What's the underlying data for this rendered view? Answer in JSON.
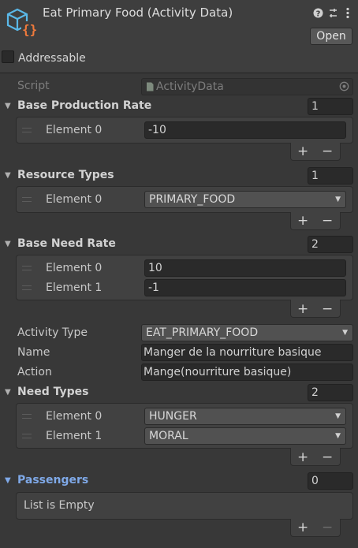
{
  "header": {
    "title": "Eat Primary Food (Activity Data)",
    "open_label": "Open",
    "icons": {
      "component": "cube-script-icon",
      "help": "question-icon",
      "presets": "sliders-icon",
      "menu": "kebab-menu-icon"
    }
  },
  "addressable": {
    "label": "Addressable",
    "checked": false
  },
  "script": {
    "label": "Script",
    "value": "ActivityData"
  },
  "base_production_rate": {
    "label": "Base Production Rate",
    "size": "1",
    "elements": [
      {
        "label": "Element 0",
        "value": "-10"
      }
    ]
  },
  "resource_types": {
    "label": "Resource Types",
    "size": "1",
    "elements": [
      {
        "label": "Element 0",
        "value": "PRIMARY_FOOD"
      }
    ]
  },
  "base_need_rate": {
    "label": "Base Need Rate",
    "size": "2",
    "elements": [
      {
        "label": "Element 0",
        "value": "10"
      },
      {
        "label": "Element 1",
        "value": "-1"
      }
    ]
  },
  "activity_type": {
    "label": "Activity Type",
    "value": "EAT_PRIMARY_FOOD"
  },
  "name": {
    "label": "Name",
    "value": "Manger de la nourriture basique"
  },
  "action": {
    "label": "Action",
    "value": "Mange(nourriture basique)"
  },
  "need_types": {
    "label": "Need Types",
    "size": "2",
    "elements": [
      {
        "label": "Element 0",
        "value": "HUNGER"
      },
      {
        "label": "Element 1",
        "value": "MORAL"
      }
    ]
  },
  "passengers": {
    "label": "Passengers",
    "size": "0",
    "empty_text": "List is Empty"
  },
  "list_controls": {
    "add": "+",
    "remove": "−"
  },
  "colors": {
    "accent_blue": "#7fa9e8",
    "background": "#383838",
    "field": "#2a2a2a"
  }
}
